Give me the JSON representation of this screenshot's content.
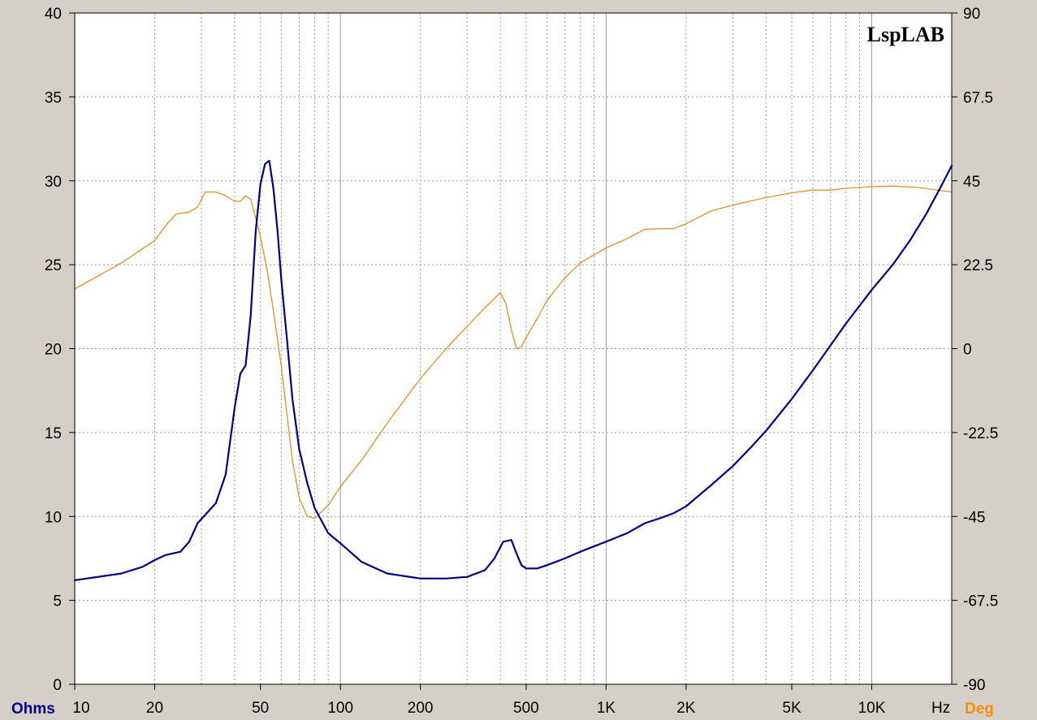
{
  "chart_data": {
    "type": "line",
    "watermark": "LspLAB",
    "x_scale": "log",
    "xlim": [
      10,
      20000
    ],
    "x_ticks": [
      {
        "value": 10,
        "label": "10"
      },
      {
        "value": 20,
        "label": "20"
      },
      {
        "value": 50,
        "label": "50"
      },
      {
        "value": 100,
        "label": "100"
      },
      {
        "value": 200,
        "label": "200"
      },
      {
        "value": 500,
        "label": "500"
      },
      {
        "value": 1000,
        "label": "1K"
      },
      {
        "value": 2000,
        "label": "2K"
      },
      {
        "value": 5000,
        "label": "5K"
      },
      {
        "value": 10000,
        "label": "10K"
      }
    ],
    "x_unit_label": "Hz",
    "y_left": {
      "label": "Ohms",
      "color": "#00008b",
      "lim": [
        0,
        40
      ],
      "ticks": [
        "0",
        "5",
        "10",
        "15",
        "20",
        "25",
        "30",
        "35",
        "40"
      ]
    },
    "y_right": {
      "label": "Deg",
      "color": "#ff8c00",
      "lim": [
        -90,
        90
      ],
      "ticks": [
        "-90",
        "-67.5",
        "-45",
        "-22.5",
        "0",
        "22.5",
        "45",
        "67.5",
        "90"
      ]
    },
    "grid": true,
    "series": [
      {
        "axis": "left",
        "color": "#000080",
        "x": [
          10,
          15,
          18,
          20,
          22,
          25,
          27,
          29,
          31,
          34,
          37,
          40,
          42,
          44,
          46,
          48,
          50,
          52,
          54,
          56,
          58,
          60,
          63,
          66,
          70,
          75,
          80,
          90,
          100,
          120,
          150,
          200,
          250,
          300,
          350,
          380,
          410,
          440,
          460,
          480,
          500,
          550,
          600,
          700,
          800,
          1000,
          1200,
          1400,
          1600,
          1800,
          2000,
          2500,
          3000,
          3500,
          4000,
          5000,
          6000,
          7000,
          8000,
          10000,
          12000,
          14000,
          16000,
          18000,
          20000
        ],
        "y": [
          6.2,
          6.6,
          7.0,
          7.4,
          7.7,
          7.9,
          8.5,
          9.6,
          10.1,
          10.8,
          12.5,
          16.5,
          18.5,
          19.0,
          22.0,
          27.0,
          29.8,
          31.0,
          31.2,
          29.5,
          27.0,
          24.0,
          20.5,
          17.0,
          14.0,
          12.0,
          10.5,
          9.0,
          8.4,
          7.3,
          6.6,
          6.3,
          6.3,
          6.4,
          6.8,
          7.5,
          8.5,
          8.6,
          7.8,
          7.1,
          6.9,
          6.9,
          7.1,
          7.5,
          7.9,
          8.5,
          9.0,
          9.6,
          9.9,
          10.2,
          10.6,
          11.9,
          13.0,
          14.1,
          15.1,
          17.0,
          18.7,
          20.2,
          21.5,
          23.5,
          25.0,
          26.5,
          28.0,
          29.5,
          30.9
        ]
      },
      {
        "axis": "right",
        "color": "#e0902a",
        "x": [
          10,
          15,
          20,
          22,
          24,
          26,
          27,
          29,
          31,
          34,
          37,
          40,
          42,
          44,
          46,
          48,
          50,
          53,
          56,
          60,
          63,
          66,
          70,
          75,
          80,
          90,
          100,
          120,
          150,
          200,
          250,
          300,
          350,
          400,
          420,
          440,
          460,
          480,
          500,
          550,
          600,
          700,
          800,
          1000,
          1200,
          1400,
          1600,
          1800,
          2000,
          2500,
          3000,
          4000,
          5000,
          6000,
          7000,
          8000,
          10000,
          12000,
          15000,
          20000
        ],
        "y": [
          16,
          23,
          29,
          33,
          36,
          36.5,
          36.6,
          38,
          42,
          42,
          41,
          39.5,
          39.5,
          41,
          40,
          35,
          30,
          21,
          10,
          -5,
          -18,
          -30,
          -40,
          -45,
          -45.5,
          -42,
          -37,
          -30,
          -20,
          -8,
          0,
          6,
          11,
          15,
          12,
          5,
          0,
          0.5,
          3,
          8,
          13,
          19,
          23,
          27,
          29.5,
          32,
          32.2,
          32.2,
          33.5,
          37,
          38.5,
          40.5,
          41.8,
          42.5,
          42.5,
          43,
          43.4,
          43.6,
          43.2,
          42
        ]
      }
    ]
  }
}
